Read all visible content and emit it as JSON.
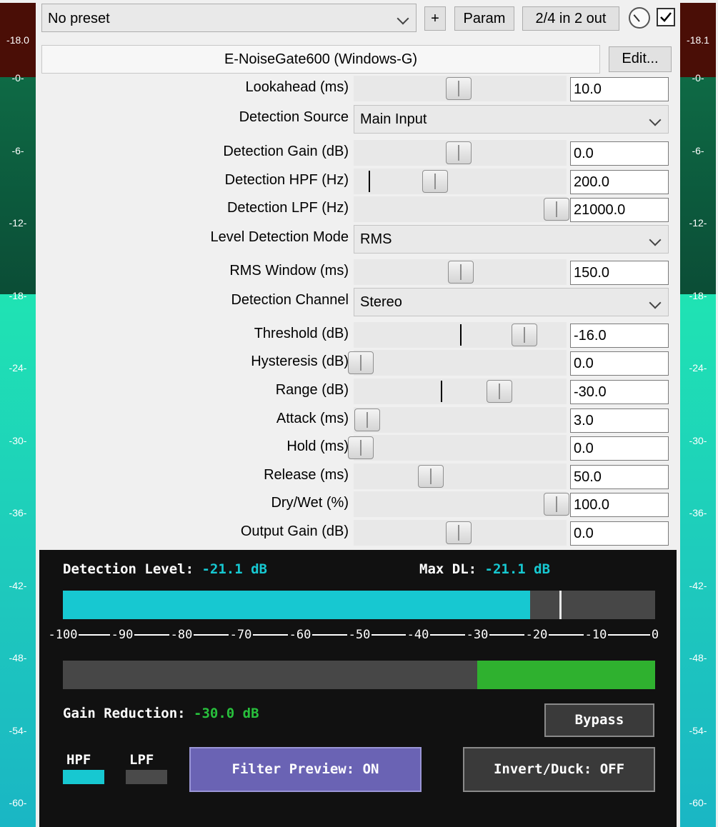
{
  "topbar": {
    "preset": "No preset",
    "add_label": "+",
    "param_label": "Param",
    "io_label": "2/4 in 2 out"
  },
  "plugin": {
    "name": "E-NoiseGate600 (Windows-G)",
    "edit_label": "Edit..."
  },
  "meters": {
    "left_peak": "-18.0",
    "right_peak": "-18.1",
    "ticks": [
      "-0-",
      "-6-",
      "-12-",
      "-18-",
      "-24-",
      "-30-",
      "-36-",
      "-42-",
      "-48-",
      "-54-",
      "-60-"
    ]
  },
  "params": [
    {
      "label": "Lookahead (ms)",
      "value": "10.0",
      "pos": 0.48
    },
    {
      "label": "Detection Source",
      "value": "Main Input"
    },
    {
      "label": "Detection Gain (dB)",
      "value": "0.0",
      "pos": 0.48,
      "default_pos": 0.48
    },
    {
      "label": "Detection HPF (Hz)",
      "value": "200.0",
      "pos": 0.37,
      "default_pos": 0.07
    },
    {
      "label": "Detection LPF (Hz)",
      "value": "21000.0",
      "pos": 0.94
    },
    {
      "label": "Level Detection Mode",
      "value": "RMS"
    },
    {
      "label": "RMS Window (ms)",
      "value": "150.0",
      "pos": 0.49
    },
    {
      "label": "Detection Channel",
      "value": "Stereo"
    },
    {
      "label": "Threshold (dB)",
      "value": "-16.0",
      "pos": 0.79,
      "default_pos": 0.5
    },
    {
      "label": "Hysteresis (dB)",
      "value": "0.0",
      "pos": 0.02
    },
    {
      "label": "Range (dB)",
      "value": "-30.0",
      "pos": 0.67,
      "default_pos": 0.41
    },
    {
      "label": "Attack (ms)",
      "value": "3.0",
      "pos": 0.05
    },
    {
      "label": "Hold (ms)",
      "value": "0.0",
      "pos": 0.02
    },
    {
      "label": "Release (ms)",
      "value": "50.0",
      "pos": 0.35
    },
    {
      "label": "Dry/Wet (%)",
      "value": "100.0",
      "pos": 0.94
    },
    {
      "label": "Output Gain (dB)",
      "value": "0.0",
      "pos": 0.48
    }
  ],
  "gate": {
    "detection_level_label": "Detection Level:",
    "detection_level_value": "-21.1 dB",
    "max_dl_label": "Max DL:",
    "max_dl_value": "-21.1 dB",
    "detection_level_db": -21.1,
    "threshold_marker_db": -16,
    "scale": [
      "-100",
      "-90",
      "-80",
      "-70",
      "-60",
      "-50",
      "-40",
      "-30",
      "-20",
      "-10",
      "0"
    ],
    "gain_reduction_label": "Gain Reduction:",
    "gain_reduction_value": "-30.0 dB",
    "gain_reduction_db": -30,
    "bypass_label": "Bypass",
    "hpf_label": "HPF",
    "lpf_label": "LPF",
    "filter_preview_label": "Filter Preview: ON",
    "invert_duck_label": "Invert/Duck: OFF"
  },
  "colors": {
    "cyan": "#17c8d1",
    "green": "#28c03c",
    "filter_preview_bg": "#6a63b4",
    "meter_dark": "#0b4d36",
    "meter_light": "#1ec9bd",
    "meter_clip": "#4a0e06"
  }
}
